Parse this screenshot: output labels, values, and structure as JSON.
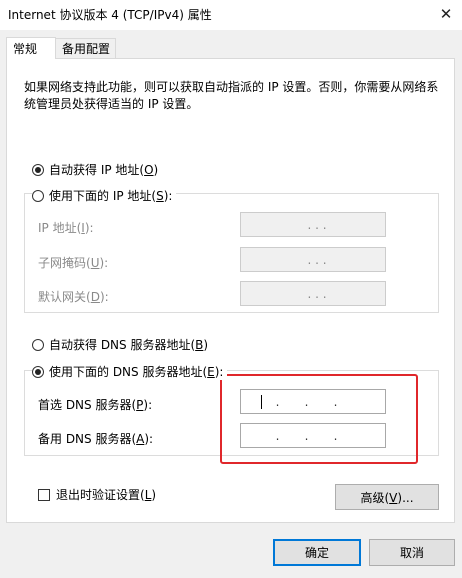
{
  "window": {
    "title": "Internet 协议版本 4 (TCP/IPv4) 属性",
    "close_glyph": "✕"
  },
  "tabs": [
    {
      "label": "常规",
      "selected": true
    },
    {
      "label": "备用配置",
      "selected": false
    }
  ],
  "description": "如果网络支持此功能，则可以获取自动指派的 IP 设置。否则，你需要从网络系统管理员处获得适当的 IP 设置。",
  "ip_mode": {
    "auto": {
      "label": "自动获得 IP 地址(",
      "key": "O",
      "end": ")",
      "selected": true
    },
    "manual": {
      "label": "使用下面的 IP 地址(",
      "key": "S",
      "end": "):",
      "selected": false
    }
  },
  "ip_fields": [
    {
      "label": "IP 地址(",
      "key": "I",
      "end": "):",
      "value": ".   .   ."
    },
    {
      "label": "子网掩码(",
      "key": "U",
      "end": "):",
      "value": ".   .   ."
    },
    {
      "label": "默认网关(",
      "key": "D",
      "end": "):",
      "value": ".   .   ."
    }
  ],
  "dns_mode": {
    "auto": {
      "label": "自动获得 DNS 服务器地址(",
      "key": "B",
      "end": ")",
      "selected": false
    },
    "manual": {
      "label": "使用下面的 DNS 服务器地址(",
      "key": "E",
      "end": "):",
      "selected": true
    }
  },
  "dns_fields": [
    {
      "label": "首选 DNS 服务器(",
      "key": "P",
      "end": "):",
      "value": ""
    },
    {
      "label": "备用 DNS 服务器(",
      "key": "A",
      "end": "):",
      "value": ""
    }
  ],
  "validate_checkbox": {
    "label": "退出时验证设置(",
    "key": "L",
    "end": ")",
    "checked": false
  },
  "buttons": {
    "advanced": {
      "label": "高级(",
      "key": "V",
      "end": ")..."
    },
    "ok": "确定",
    "cancel": "取消"
  },
  "colors": {
    "highlight": "#e0272b",
    "accent": "#0078d7"
  }
}
